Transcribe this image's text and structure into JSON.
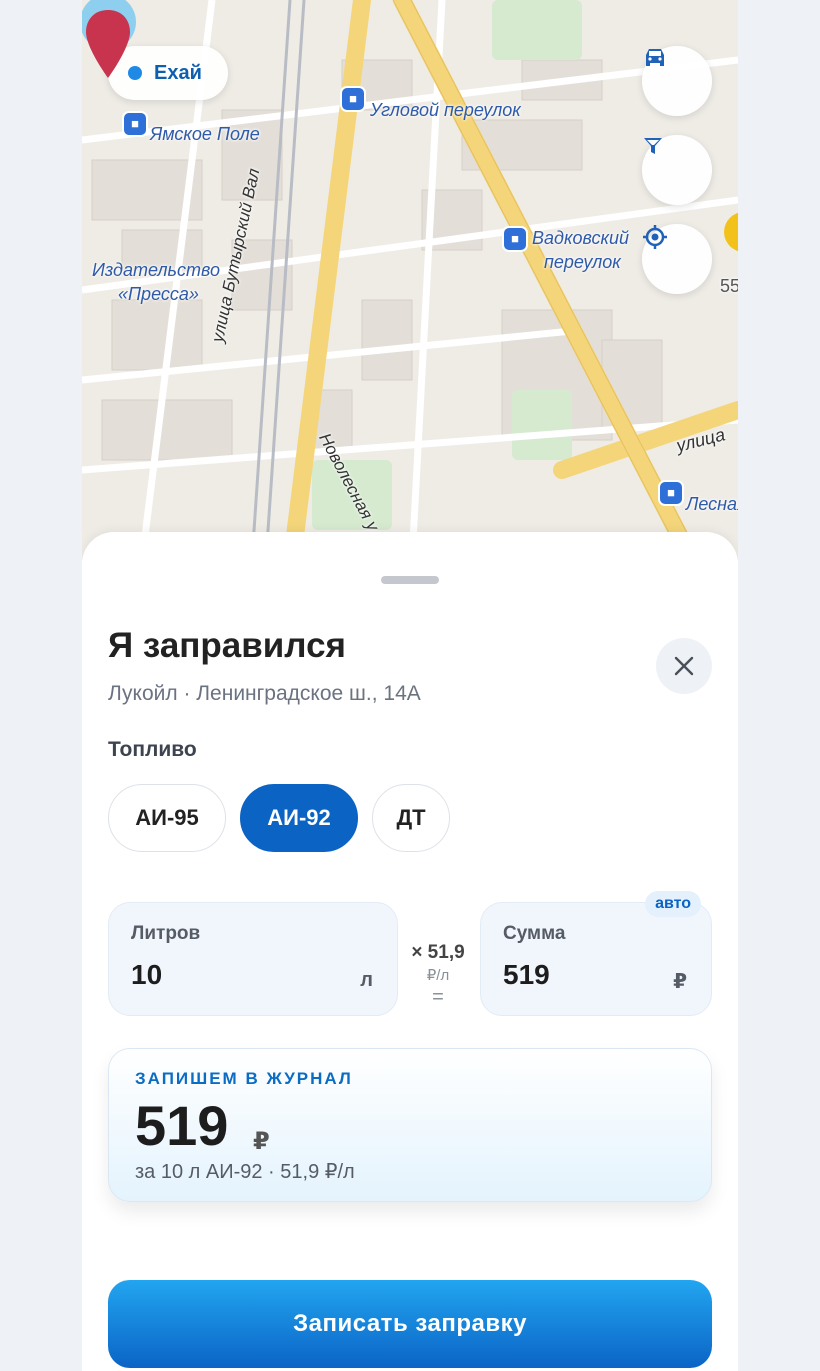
{
  "map": {
    "brand_chip": {
      "label": "Ехай",
      "dot_color": "#1e8ae6"
    },
    "labels": {
      "yamskoe": "Ямское Поле",
      "uglovoy": "Угловой переулок",
      "vadkovsky_1": "Вадковский",
      "vadkovsky_2": "переулок",
      "izdatelstvo_1": "Издательство",
      "izdatelstvo_2": "«Пресса»",
      "butyrsky": "улица Бутырский Вал",
      "novolesnaya": "Новолесная у",
      "ulitsa": "улица",
      "lesnaya": "Лесная",
      "num": "55"
    },
    "buttons": [
      "car-icon",
      "filter-icon",
      "locate-icon"
    ]
  },
  "sheet": {
    "title": "Я заправился",
    "subtitle": "Лукойл · Ленинградское ш., 14А",
    "fuel_label": "Топливо",
    "fuel_options": [
      {
        "label": "АИ-95",
        "selected": false
      },
      {
        "label": "АИ-92",
        "selected": true
      },
      {
        "label": "ДТ",
        "selected": false
      }
    ],
    "liters": {
      "label": "Литров",
      "value": "10",
      "unit": "л"
    },
    "price": {
      "times": "× 51,9",
      "unit": "₽/л",
      "equals": "="
    },
    "sum": {
      "label": "Сумма",
      "value": "519",
      "unit": "₽",
      "badge": "авто"
    },
    "journal": {
      "caption": "ЗАПИШЕМ В ЖУРНАЛ",
      "amount": "519",
      "currency": "₽",
      "details": "за 10 л АИ-92 · 51,9 ₽/л"
    },
    "submit_label": "Записать заправку"
  },
  "colors": {
    "accent": "#0b63c4",
    "map_bg": "#efece6",
    "road": "#f4d57a",
    "pin": "#c8344e"
  }
}
